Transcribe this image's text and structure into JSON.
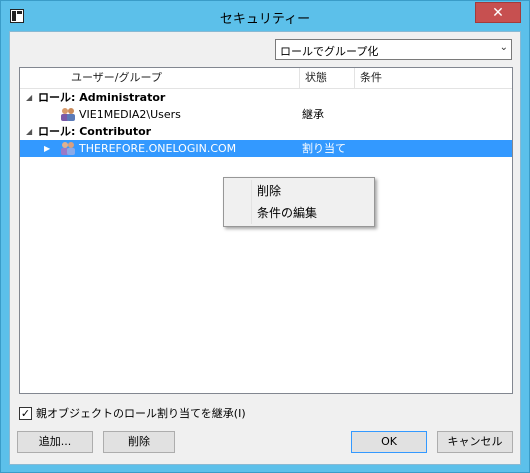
{
  "window": {
    "title": "セキュリティー"
  },
  "groupby": {
    "selected": "ロールでグループ化"
  },
  "table": {
    "columns": [
      "ユーザー/グループ",
      "状態",
      "条件"
    ],
    "groups": [
      {
        "title": "ロール: Administrator",
        "rows": [
          {
            "name": "VIE1MEDIA2\\Users",
            "status": "継承",
            "condition": ""
          }
        ]
      },
      {
        "title": "ロール: Contributor",
        "rows": [
          {
            "name": "THEREFORE.ONELOGIN.COM",
            "status": "割り当て",
            "condition": ""
          }
        ]
      }
    ]
  },
  "context_menu": {
    "items": [
      "削除",
      "条件の編集"
    ]
  },
  "inherit": {
    "label": "親オブジェクトのロール割り当てを継承(I)",
    "checked": true
  },
  "buttons": {
    "add": "追加...",
    "delete": "削除",
    "ok": "OK",
    "cancel": "キャンセル"
  },
  "icons": {
    "close": "close-icon",
    "dropdown": "chevron-down-icon",
    "app": "app-icon",
    "user_group": "user-group-icon"
  },
  "colors": {
    "selection": "#3399ff",
    "title_bar": "#5cc0ea",
    "close": "#c75050"
  }
}
